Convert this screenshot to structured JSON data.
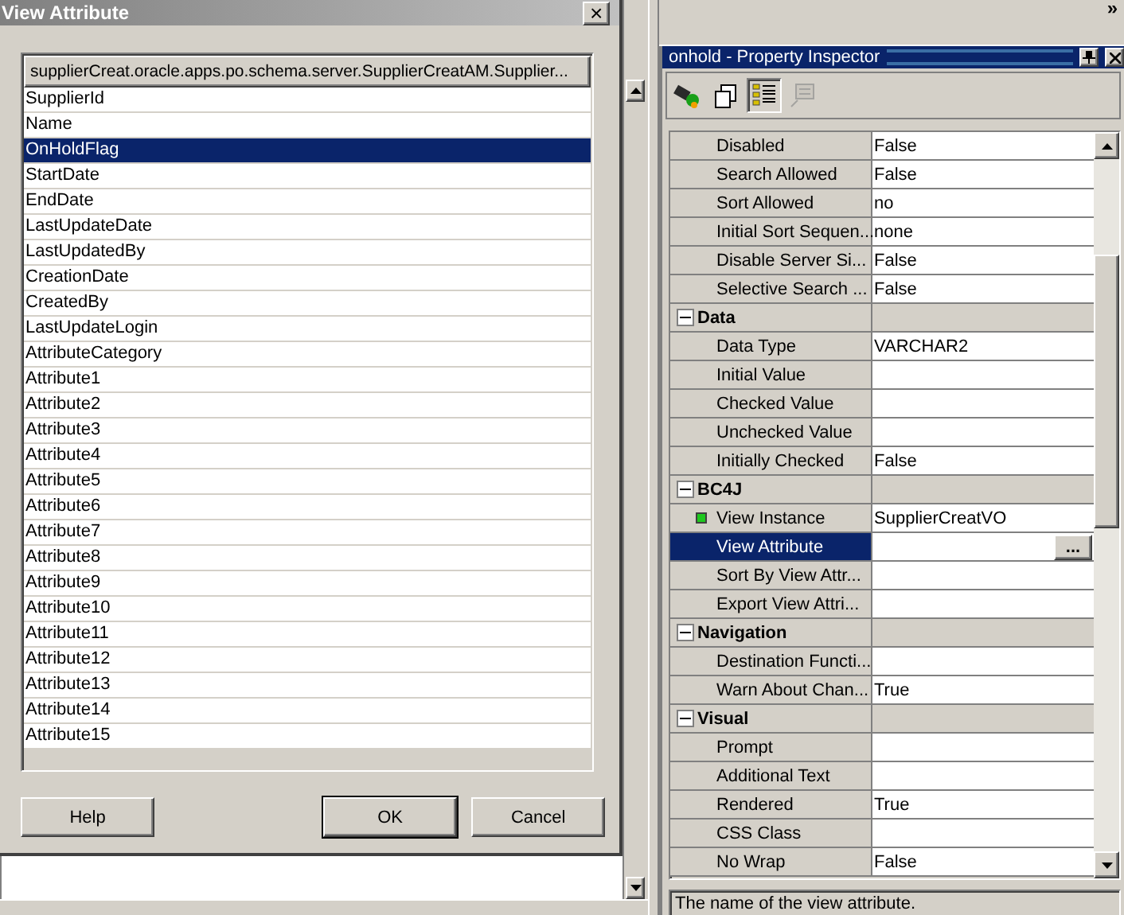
{
  "dialog": {
    "title": "View Attribute",
    "close": "×",
    "list_header": "supplierCreat.oracle.apps.po.schema.server.SupplierCreatAM.Supplier...",
    "items": [
      {
        "label": "SupplierId",
        "selected": false
      },
      {
        "label": "Name",
        "selected": false
      },
      {
        "label": "OnHoldFlag",
        "selected": true
      },
      {
        "label": "StartDate",
        "selected": false
      },
      {
        "label": "EndDate",
        "selected": false
      },
      {
        "label": "LastUpdateDate",
        "selected": false
      },
      {
        "label": "LastUpdatedBy",
        "selected": false
      },
      {
        "label": "CreationDate",
        "selected": false
      },
      {
        "label": "CreatedBy",
        "selected": false
      },
      {
        "label": "LastUpdateLogin",
        "selected": false
      },
      {
        "label": "AttributeCategory",
        "selected": false
      },
      {
        "label": "Attribute1",
        "selected": false
      },
      {
        "label": "Attribute2",
        "selected": false
      },
      {
        "label": "Attribute3",
        "selected": false
      },
      {
        "label": "Attribute4",
        "selected": false
      },
      {
        "label": "Attribute5",
        "selected": false
      },
      {
        "label": "Attribute6",
        "selected": false
      },
      {
        "label": "Attribute7",
        "selected": false
      },
      {
        "label": "Attribute8",
        "selected": false
      },
      {
        "label": "Attribute9",
        "selected": false
      },
      {
        "label": "Attribute10",
        "selected": false
      },
      {
        "label": "Attribute11",
        "selected": false
      },
      {
        "label": "Attribute12",
        "selected": false
      },
      {
        "label": "Attribute13",
        "selected": false
      },
      {
        "label": "Attribute14",
        "selected": false
      },
      {
        "label": "Attribute15",
        "selected": false
      }
    ],
    "buttons": [
      {
        "label": "Help",
        "default": false
      },
      {
        "label": "OK",
        "default": true
      },
      {
        "label": "Cancel",
        "default": false
      }
    ]
  },
  "overflow": "»",
  "inspector": {
    "title": "onhold - Property Inspector",
    "toolbar": [
      {
        "kind": "find",
        "selected": false,
        "disabled": false
      },
      {
        "kind": "copy",
        "selected": false,
        "disabled": false
      },
      {
        "kind": "categories",
        "selected": true,
        "disabled": false
      },
      {
        "kind": "description",
        "selected": false,
        "disabled": true
      }
    ],
    "rows": [
      {
        "kind": "property",
        "name": "Disabled",
        "value": "False",
        "selected": false
      },
      {
        "kind": "property",
        "name": "Search Allowed",
        "value": "False",
        "selected": false
      },
      {
        "kind": "property",
        "name": "Sort Allowed",
        "value": "no",
        "selected": false
      },
      {
        "kind": "property",
        "name": "Initial Sort Sequen...",
        "value": "none",
        "selected": false
      },
      {
        "kind": "property",
        "name": "Disable Server Si...",
        "value": "False",
        "selected": false
      },
      {
        "kind": "property",
        "name": "Selective Search ...",
        "value": "False",
        "selected": false
      },
      {
        "kind": "category",
        "name": "Data",
        "expanded": true
      },
      {
        "kind": "property",
        "name": "Data Type",
        "value": "VARCHAR2",
        "selected": false
      },
      {
        "kind": "property",
        "name": "Initial Value",
        "selected": false
      },
      {
        "kind": "property",
        "name": "Checked Value",
        "selected": false
      },
      {
        "kind": "property",
        "name": "Unchecked Value",
        "selected": false
      },
      {
        "kind": "property",
        "name": "Initially Checked",
        "value": "False",
        "selected": false
      },
      {
        "kind": "category",
        "name": "BC4J",
        "expanded": true
      },
      {
        "kind": "property",
        "name": "View Instance",
        "value": "SupplierCreatVO",
        "selected": false,
        "marked": true
      },
      {
        "kind": "property",
        "name": "View Attribute",
        "selected": true,
        "button": "..."
      },
      {
        "kind": "property",
        "name": "Sort By View Attr...",
        "selected": false
      },
      {
        "kind": "property",
        "name": "Export View Attri...",
        "selected": false
      },
      {
        "kind": "category",
        "name": "Navigation",
        "expanded": true
      },
      {
        "kind": "property",
        "name": "Destination Functi...",
        "selected": false
      },
      {
        "kind": "property",
        "name": "Warn About Chan...",
        "value": "True",
        "selected": false
      },
      {
        "kind": "category",
        "name": "Visual",
        "expanded": true
      },
      {
        "kind": "property",
        "name": "Prompt",
        "selected": false
      },
      {
        "kind": "property",
        "name": "Additional Text",
        "selected": false
      },
      {
        "kind": "property",
        "name": "Rendered",
        "value": "True",
        "selected": false
      },
      {
        "kind": "property",
        "name": "CSS Class",
        "selected": false
      },
      {
        "kind": "property",
        "name": "No Wrap",
        "value": "False",
        "selected": false
      }
    ],
    "description": "The name of the view attribute."
  }
}
